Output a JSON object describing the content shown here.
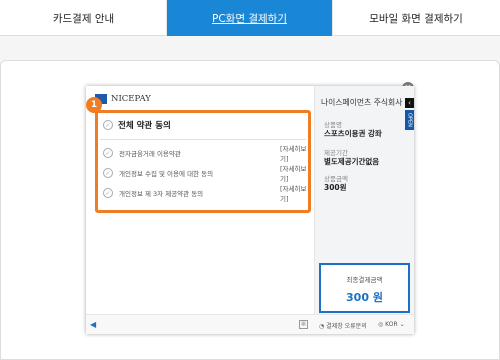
{
  "tabs": [
    {
      "label": "카드결제 안내"
    },
    {
      "label": "PC화면 결제하기"
    },
    {
      "label": "모바일 화면 결제하기"
    }
  ],
  "modal": {
    "logo_text": "NICEPAY",
    "badge": "1",
    "agree_all": "전체 약관 동의",
    "terms": [
      {
        "label": "전자금융거래 이용약관",
        "link": "[자세히보기]"
      },
      {
        "label": "개인정보 수집 및 이용에 대한 동의",
        "link": "[자세히보기]"
      },
      {
        "label": "개인정보 제 3자 제공약관 동의",
        "link": "[자세히보기]"
      }
    ],
    "merchant": "나이스페이먼츠 주식회사",
    "info_tab": "OPEN",
    "product_label": "상품명",
    "product_value": "스포츠이용권 강좌",
    "period_label": "제공기간",
    "period_value": "별도제공기간없음",
    "price_label": "상품금액",
    "price_value": "300원",
    "total_label": "최종결제금액",
    "total_value": "300 원",
    "footer_text": "결제창 오류문의",
    "lang": "KOR"
  },
  "colors": {
    "accent": "#1a86d6",
    "highlight": "#ef7d23",
    "total": "#1d6fc4"
  }
}
